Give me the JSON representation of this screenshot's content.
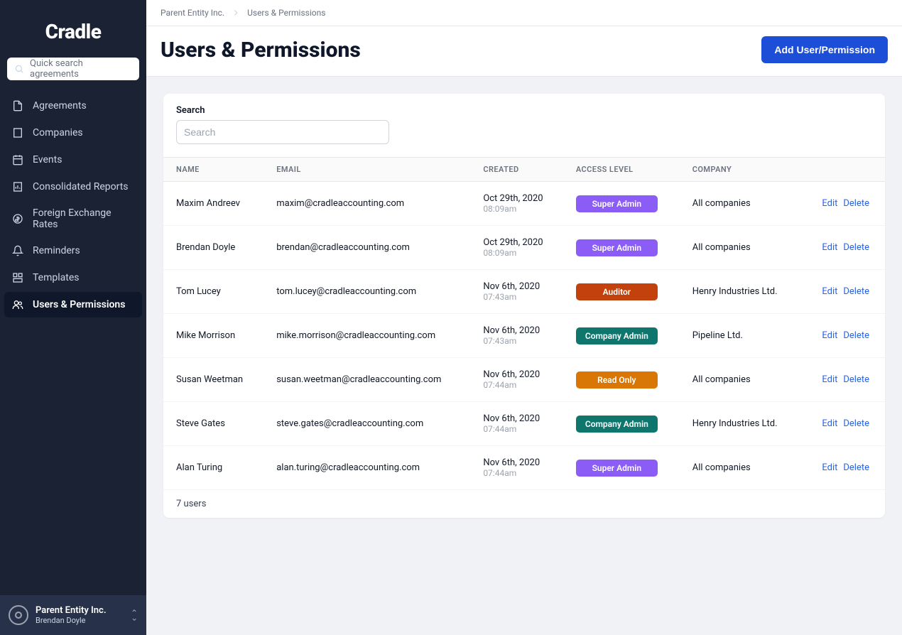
{
  "app": {
    "name": "Cradle"
  },
  "search_sidebar": {
    "placeholder": "Quick search agreements"
  },
  "nav": [
    {
      "label": "Agreements",
      "icon": "document-icon"
    },
    {
      "label": "Companies",
      "icon": "building-icon"
    },
    {
      "label": "Events",
      "icon": "calendar-icon"
    },
    {
      "label": "Consolidated Reports",
      "icon": "report-icon"
    },
    {
      "label": "Foreign Exchange Rates",
      "icon": "currency-icon"
    },
    {
      "label": "Reminders",
      "icon": "bell-icon"
    },
    {
      "label": "Templates",
      "icon": "template-icon"
    },
    {
      "label": "Users & Permissions",
      "icon": "users-icon",
      "active": true
    }
  ],
  "footer": {
    "entity": "Parent Entity Inc.",
    "user": "Brendan Doyle"
  },
  "breadcrumb": {
    "root": "Parent Entity Inc.",
    "current": "Users & Permissions"
  },
  "page": {
    "title": "Users & Permissions",
    "primary_button": "Add User/Permission"
  },
  "search_card": {
    "label": "Search",
    "placeholder": "Search"
  },
  "table": {
    "columns": {
      "name": "Name",
      "email": "Email",
      "created": "Created",
      "access": "Access Level",
      "company": "Company"
    },
    "actions": {
      "edit": "Edit",
      "delete": "Delete"
    },
    "rows": [
      {
        "name": "Maxim Andreev",
        "email": "maxim@cradleaccounting.com",
        "date": "Oct 29th, 2020",
        "time": "08:09am",
        "access": "Super Admin",
        "access_class": "super-admin",
        "company": "All companies"
      },
      {
        "name": "Brendan Doyle",
        "email": "brendan@cradleaccounting.com",
        "date": "Oct 29th, 2020",
        "time": "08:09am",
        "access": "Super Admin",
        "access_class": "super-admin",
        "company": "All companies"
      },
      {
        "name": "Tom Lucey",
        "email": "tom.lucey@cradleaccounting.com",
        "date": "Nov 6th, 2020",
        "time": "07:43am",
        "access": "Auditor",
        "access_class": "auditor",
        "company": "Henry Industries Ltd."
      },
      {
        "name": "Mike Morrison",
        "email": "mike.morrison@cradleaccounting.com",
        "date": "Nov 6th, 2020",
        "time": "07:43am",
        "access": "Company Admin",
        "access_class": "company-admin",
        "company": "Pipeline Ltd."
      },
      {
        "name": "Susan Weetman",
        "email": "susan.weetman@cradleaccounting.com",
        "date": "Nov 6th, 2020",
        "time": "07:44am",
        "access": "Read Only",
        "access_class": "read-only",
        "company": "All companies"
      },
      {
        "name": "Steve Gates",
        "email": "steve.gates@cradleaccounting.com",
        "date": "Nov 6th, 2020",
        "time": "07:44am",
        "access": "Company Admin",
        "access_class": "company-admin",
        "company": "Henry Industries Ltd."
      },
      {
        "name": "Alan Turing",
        "email": "alan.turing@cradleaccounting.com",
        "date": "Nov 6th, 2020",
        "time": "07:44am",
        "access": "Super Admin",
        "access_class": "super-admin",
        "company": "All companies"
      }
    ],
    "footer": "7 users"
  }
}
